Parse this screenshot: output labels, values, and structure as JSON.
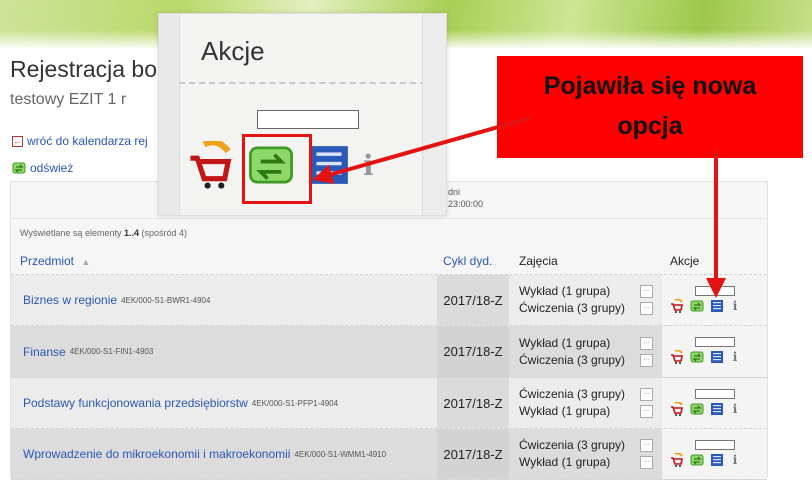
{
  "page": {
    "title": "Rejestracja bo",
    "subtitle": "testowy EZIT 1 r",
    "back_link": "wróć do kalendarza rej",
    "refresh_link": "odśwież"
  },
  "registration": {
    "deadline_label": "dni",
    "deadline_time": "23:00:00"
  },
  "table": {
    "count_prefix": "Wyświetlane są elementy ",
    "count_range": "1..4",
    "count_suffix": " (spośród 4)",
    "headers": {
      "subject": "Przedmiot",
      "sort_indicator": "▲",
      "cycle": "Cykl dyd.",
      "classes": "Zajęcia",
      "actions": "Akcje"
    },
    "rows": [
      {
        "name": "Biznes w regionie",
        "code": "4EK/000-S1-BWR1-4904",
        "cycle": "2017/18-Z",
        "classes": [
          "Wykład (1 grupa)",
          "Ćwiczenia (3 grupy)"
        ]
      },
      {
        "name": "Finanse",
        "code": "4EK/000-S1-FIN1-4903",
        "cycle": "2017/18-Z",
        "classes": [
          "Wykład (1 grupa)",
          "Ćwiczenia (3 grupy)"
        ]
      },
      {
        "name": "Podstawy funkcjonowania przedsiębiorstw",
        "code": "4EK/000-S1-PFP1-4904",
        "cycle": "2017/18-Z",
        "classes": [
          "Ćwiczenia (3 grupy)",
          "Wykład (1 grupa)"
        ]
      },
      {
        "name": "Wprowadzenie do mikroekonomii i makroekonomii",
        "code": "4EK/000-S1-WMM1-4910",
        "cycle": "2017/18-Z",
        "classes": [
          "Ćwiczenia (3 grupy)",
          "Wykład (1 grupa)"
        ]
      }
    ],
    "more_button": "…",
    "info_glyph": "i"
  },
  "zoom": {
    "title": "Akcje",
    "info_glyph": "i"
  },
  "callout": {
    "line1": "Pojawiła się nowa",
    "line2": "opcja"
  },
  "icons": {
    "back": "back-arrow-icon",
    "refresh": "refresh-icon",
    "cart": "cart-icon",
    "swap": "swap-group-icon",
    "list": "list-icon",
    "info": "info-icon"
  },
  "colors": {
    "link": "#2a56b5",
    "highlight": "#e31313",
    "callout_bg": "#ff0000",
    "swap_icon": "#57c230"
  }
}
